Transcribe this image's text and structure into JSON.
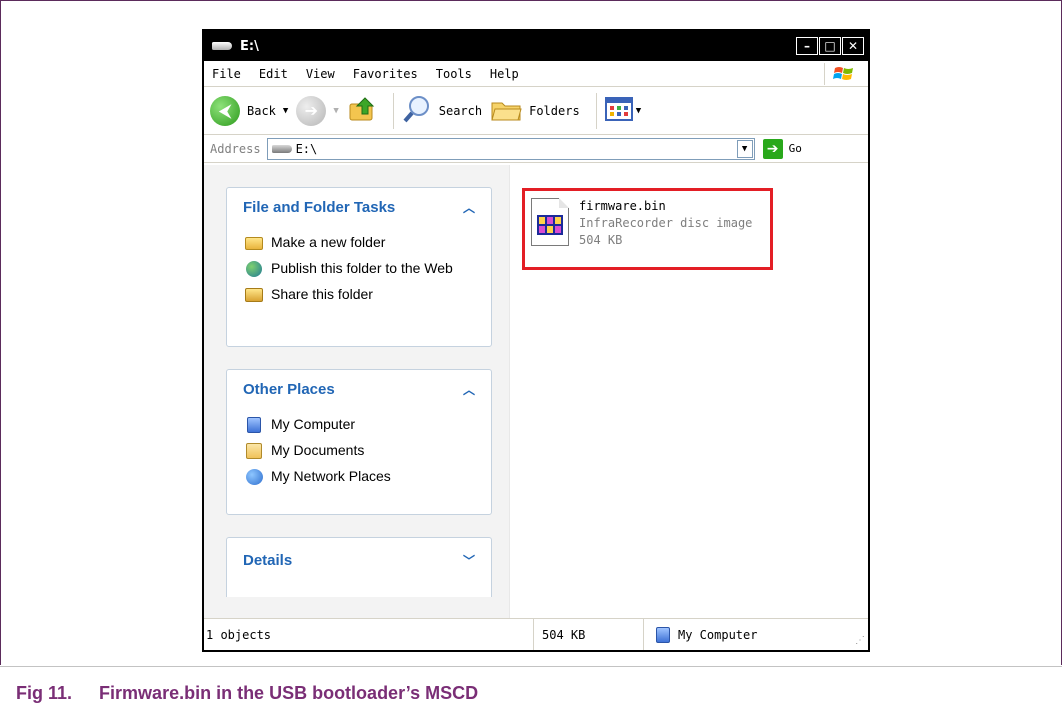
{
  "window": {
    "title": "E:\\",
    "controls": {
      "minimize": "–",
      "maximize": "□",
      "close": "✕"
    }
  },
  "menu": {
    "items": [
      "File",
      "Edit",
      "View",
      "Favorites",
      "Tools",
      "Help"
    ]
  },
  "toolbar": {
    "back_label": "Back",
    "search_label": "Search",
    "folders_label": "Folders"
  },
  "address": {
    "label": "Address",
    "value": "E:\\",
    "go_label": "Go"
  },
  "tasks_panel": {
    "title": "File and Folder Tasks",
    "items": [
      "Make a new folder",
      "Publish this folder to the Web",
      "Share this folder"
    ]
  },
  "places_panel": {
    "title": "Other Places",
    "items": [
      "My Computer",
      "My Documents",
      "My Network Places"
    ]
  },
  "details_panel": {
    "title": "Details"
  },
  "file": {
    "name": "firmware.bin",
    "type": "InfraRecorder disc image",
    "size": "504 KB"
  },
  "status": {
    "objects": "1 objects",
    "size": "504 KB",
    "zone": "My Computer"
  },
  "caption": {
    "number": "Fig 11.",
    "text": "Firmware.bin in the USB bootloader’s MSCD"
  },
  "colors": {
    "highlight_border": "#e31e25",
    "panel_title": "#2166b5",
    "caption": "#7a2e76"
  }
}
